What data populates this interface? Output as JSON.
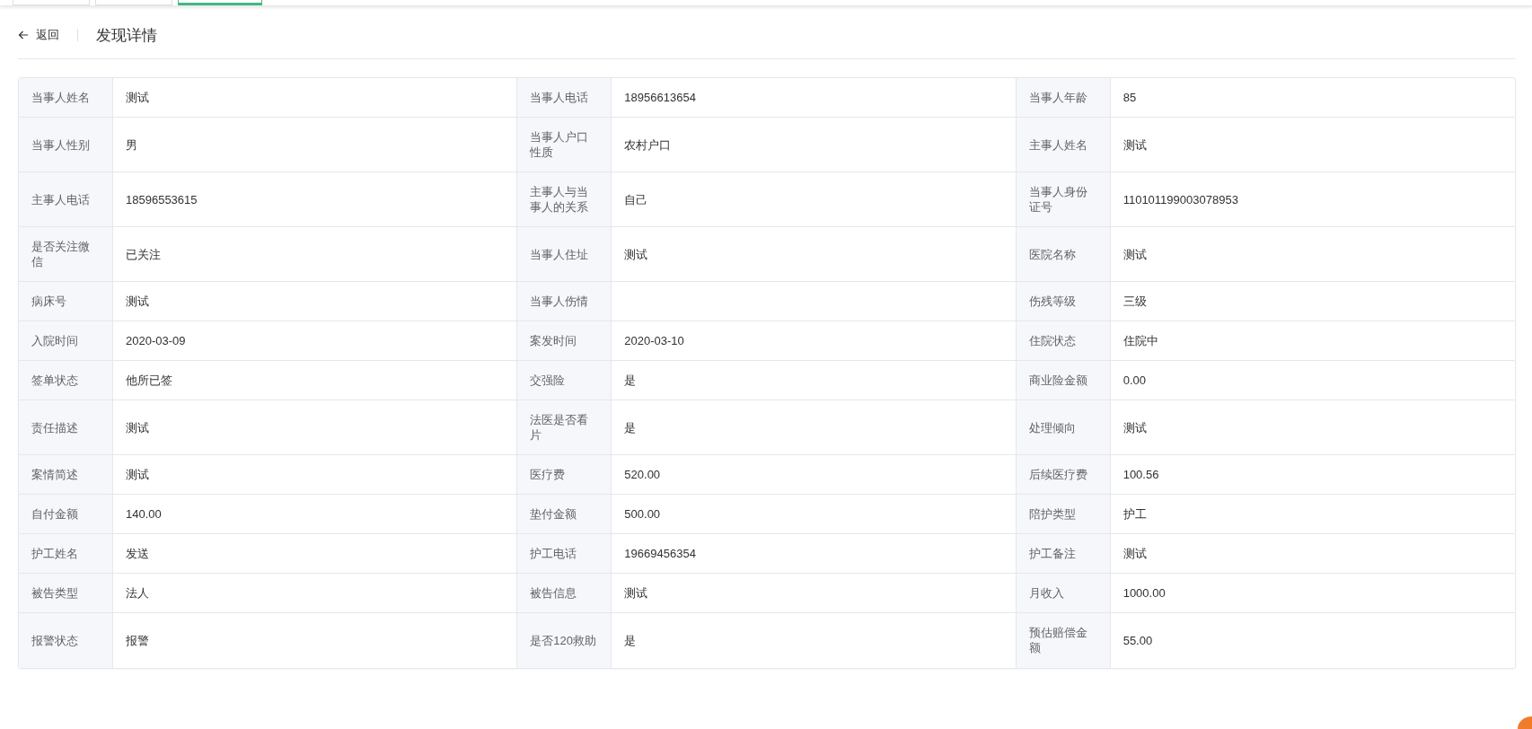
{
  "top_tabs": [
    {
      "selected": false
    },
    {
      "selected": false
    },
    {
      "selected": true
    }
  ],
  "header": {
    "back": "返回",
    "title": "发现详情"
  },
  "rows": [
    [
      {
        "label": "当事人姓名",
        "value": "测试"
      },
      {
        "label": "当事人电话",
        "value": "18956613654"
      },
      {
        "label": "当事人年龄",
        "value": "85"
      }
    ],
    [
      {
        "label": "当事人性别",
        "value": "男"
      },
      {
        "label": "当事人户口性质",
        "value": "农村户口"
      },
      {
        "label": "主事人姓名",
        "value": "测试"
      }
    ],
    [
      {
        "label": "主事人电话",
        "value": "18596553615"
      },
      {
        "label": "主事人与当事人的关系",
        "value": "自己"
      },
      {
        "label": "当事人身份证号",
        "value": "110101199003078953"
      }
    ],
    [
      {
        "label": "是否关注微信",
        "value": "已关注"
      },
      {
        "label": "当事人住址",
        "value": "测试"
      },
      {
        "label": "医院名称",
        "value": "测试"
      }
    ],
    [
      {
        "label": "病床号",
        "value": "测试"
      },
      {
        "label": "当事人伤情"
      },
      {
        "label": "伤残等级",
        "value": "三级"
      }
    ],
    [
      {
        "label": "入院时间",
        "value": "2020-03-09"
      },
      {
        "label": "案发时间",
        "value": "2020-03-10"
      },
      {
        "label": "住院状态",
        "value": "住院中"
      }
    ],
    [
      {
        "label": "签单状态",
        "value": "他所已签"
      },
      {
        "label": "交强险",
        "value": "是"
      },
      {
        "label": "商业险金额",
        "value": "0.00"
      }
    ],
    [
      {
        "label": "责任描述",
        "value": "测试"
      },
      {
        "label": "法医是否看片",
        "value": "是"
      },
      {
        "label": "处理倾向",
        "value": "测试"
      }
    ],
    [
      {
        "label": "案情简述",
        "value": "测试"
      },
      {
        "label": "医疗费",
        "value": "520.00"
      },
      {
        "label": "后续医疗费",
        "value": "100.56"
      }
    ],
    [
      {
        "label": "自付金额",
        "value": "140.00"
      },
      {
        "label": "垫付金额",
        "value": "500.00"
      },
      {
        "label": "陪护类型",
        "value": "护工"
      }
    ],
    [
      {
        "label": "护工姓名",
        "value": "发送"
      },
      {
        "label": "护工电话",
        "value": "19669456354"
      },
      {
        "label": "护工备注",
        "value": "测试"
      }
    ],
    [
      {
        "label": "被告类型",
        "value": "法人"
      },
      {
        "label": "被告信息",
        "value": "测试"
      },
      {
        "label": "月收入",
        "value": "1000.00"
      }
    ],
    [
      {
        "label": "报警状态",
        "value": "报警"
      },
      {
        "label": "是否120救助",
        "value": "是"
      },
      {
        "label": "预估赔偿金额",
        "value": "55.00"
      }
    ]
  ]
}
